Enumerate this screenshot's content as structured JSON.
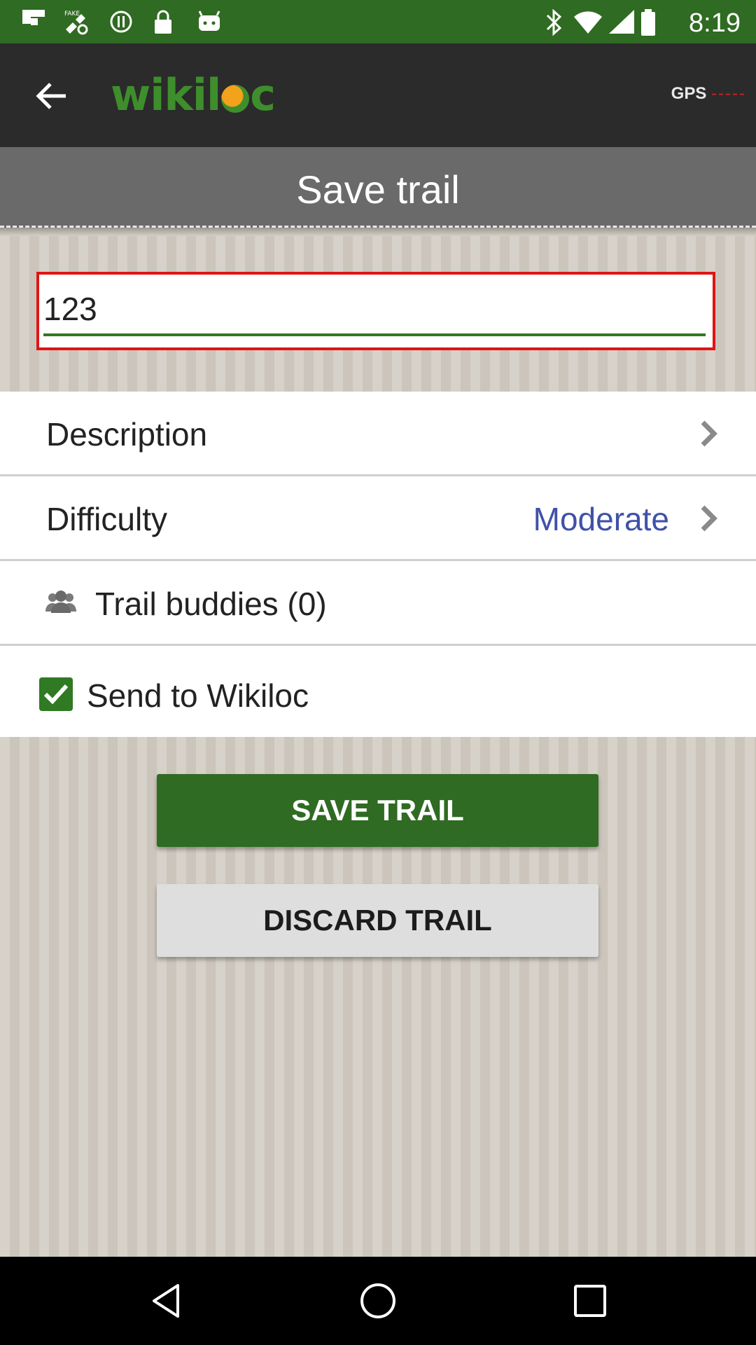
{
  "status_bar": {
    "time": "8:19",
    "icons": [
      "flipboard-icon",
      "fake-gps-icon",
      "sync-icon",
      "lock-icon",
      "android-icon",
      "bluetooth-icon",
      "wifi-icon",
      "signal-icon",
      "battery-icon"
    ]
  },
  "app_bar": {
    "logo_text_1": "wikil",
    "logo_text_2": "c",
    "gps_label": "GPS",
    "gps_dashes": "-----"
  },
  "page": {
    "title": "Save trail"
  },
  "trail_name": {
    "value": "123"
  },
  "list": {
    "description_label": "Description",
    "difficulty_label": "Difficulty",
    "difficulty_value": "Moderate",
    "buddies_label": "Trail buddies (0)",
    "send_label": "Send to Wikiloc",
    "send_checked": true
  },
  "actions": {
    "save_label": "SAVE TRAIL",
    "discard_label": "DISCARD TRAIL"
  },
  "colors": {
    "brand_green": "#2f6b22",
    "accent_blue": "#3f51a8",
    "highlight_red": "#e01414"
  }
}
